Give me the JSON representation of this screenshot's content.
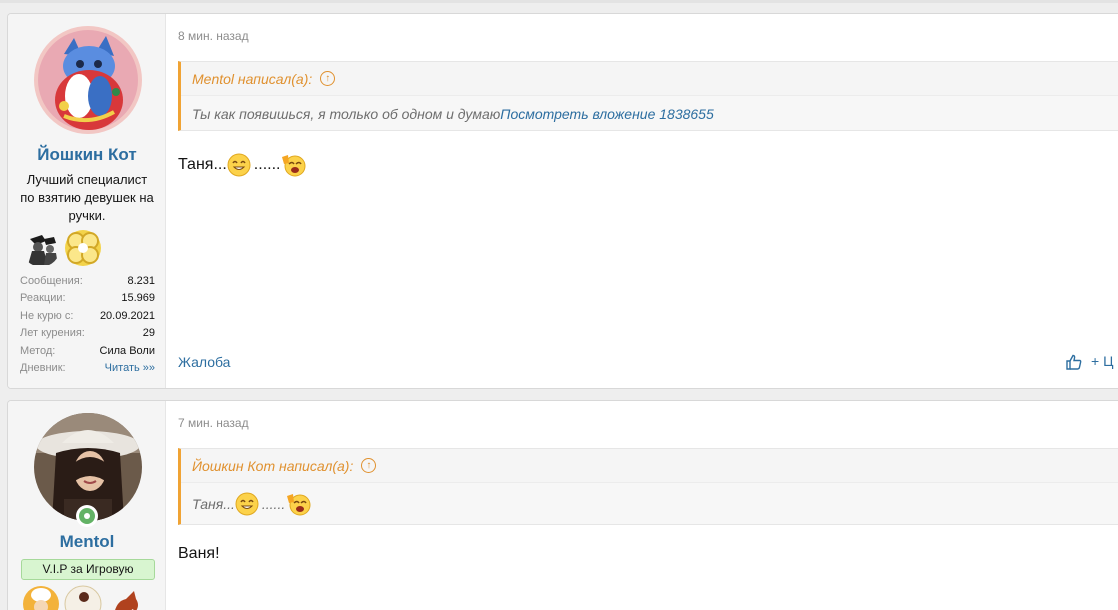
{
  "posts": [
    {
      "user": {
        "name": "Йошкин Кот",
        "title": "Лучший специалист по взятию девушек на ручки.",
        "stats": [
          {
            "label": "Сообщения:",
            "value": "8.231"
          },
          {
            "label": "Реакции:",
            "value": "15.969"
          },
          {
            "label": "Не курю с:",
            "value": "20.09.2021"
          },
          {
            "label": "Лет курения:",
            "value": "29"
          },
          {
            "label": "Метод:",
            "value": "Сила Воли"
          },
          {
            "label": "Дневник:",
            "value": "Читать »»"
          }
        ]
      },
      "time": "8 мин. назад",
      "quote": {
        "author": "Mentol написал(а):",
        "text": "Ты как появишься, я только об одном и думаю",
        "link": "Посмотреть вложение 1838655"
      },
      "message": {
        "text1": "Таня...",
        "text2": "......"
      },
      "actions": {
        "report": "Жалоба",
        "quote": "+ Ц"
      }
    },
    {
      "user": {
        "name": "Mentol",
        "banner": "V.I.P за Игровую"
      },
      "time": "7 мин. назад",
      "quote": {
        "author": "Йошкин Кот написал(а):",
        "text1": "Таня...",
        "text2": "......"
      },
      "message": {
        "text": "Ваня!"
      }
    }
  ],
  "icons": {
    "quote_arrow": "↑",
    "accent_link": "#2d6ea0",
    "accent_quote": "#f0a334"
  }
}
